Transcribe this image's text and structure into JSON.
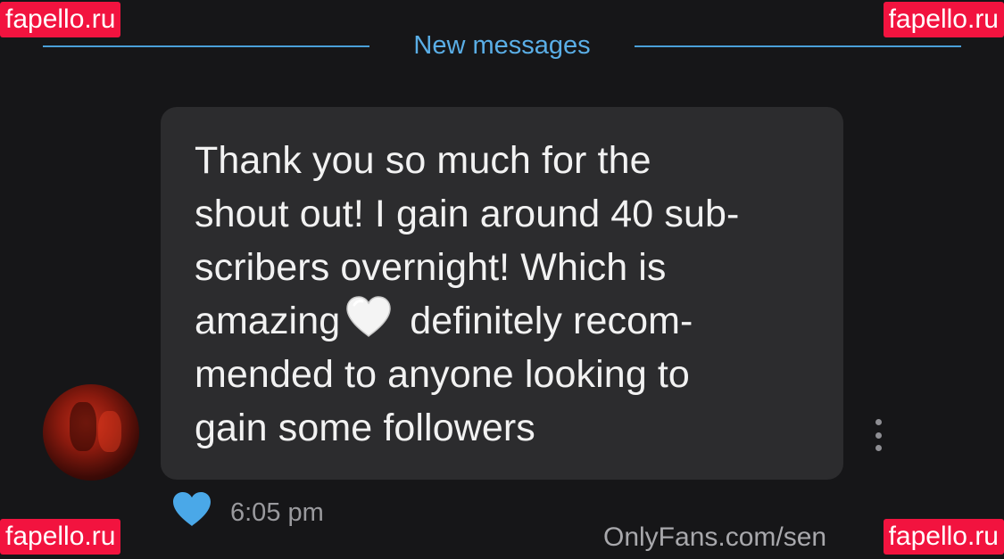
{
  "divider": {
    "label": "New messages",
    "color": "#5aaee6"
  },
  "message": {
    "lines": [
      "Thank you so much for the",
      "shout out! I gain around 40 sub-",
      "scribers overnight! Which is",
      "amazing",
      " definitely recom-",
      "mended to anyone looking to",
      "gain some followers"
    ],
    "emoji": "white-heart",
    "time": "6:05 pm",
    "liked": true
  },
  "icons": {
    "like": "heart-icon",
    "more": "more-vertical-icon",
    "avatar": "avatar"
  },
  "colors": {
    "background": "#161618",
    "bubble": "#2c2c2e",
    "like": "#4aa8e8",
    "watermark": "#f2133f"
  },
  "watermarks": {
    "top_left": "fapello.ru",
    "top_right": "fapello.ru",
    "bottom_left": "fapello.ru",
    "bottom_right": "fapello.ru"
  },
  "source_url": "OnlyFans.com/sen"
}
